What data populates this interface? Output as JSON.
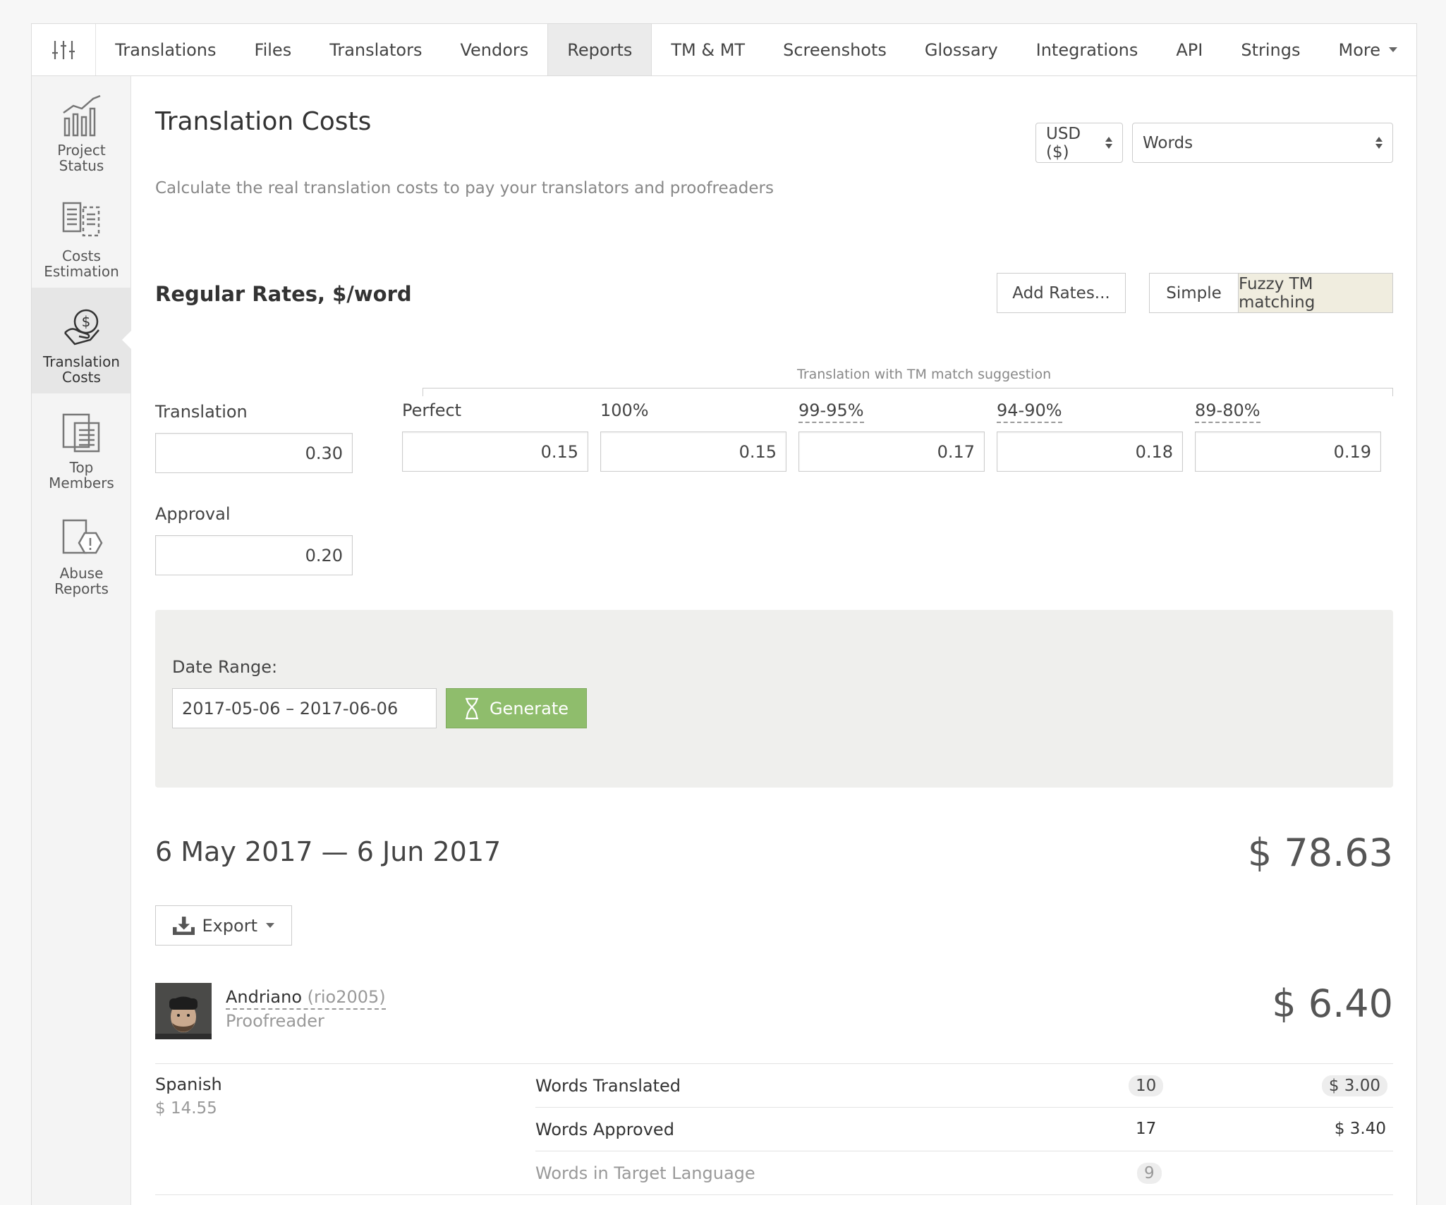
{
  "nav": {
    "tabs": [
      {
        "label": "Translations"
      },
      {
        "label": "Files"
      },
      {
        "label": "Translators"
      },
      {
        "label": "Vendors"
      },
      {
        "label": "Reports"
      },
      {
        "label": "TM & MT"
      },
      {
        "label": "Screenshots"
      },
      {
        "label": "Glossary"
      },
      {
        "label": "Integrations"
      },
      {
        "label": "API"
      },
      {
        "label": "Strings"
      },
      {
        "label": "More"
      }
    ],
    "active": "Reports"
  },
  "sidebar": {
    "items": [
      {
        "label": "Project\nStatus",
        "icon": "bar-chart-icon"
      },
      {
        "label": "Costs\nEstimation",
        "icon": "document-compare-icon"
      },
      {
        "label": "Translation\nCosts",
        "icon": "money-hand-icon"
      },
      {
        "label": "Top\nMembers",
        "icon": "document-list-icon"
      },
      {
        "label": "Abuse\nReports",
        "icon": "warning-document-icon"
      }
    ],
    "active": "Translation Costs"
  },
  "header": {
    "title": "Translation Costs",
    "subtitle": "Calculate the real translation costs to pay your translators and proofreaders",
    "currency": "USD ($)",
    "unit": "Words"
  },
  "rates": {
    "title": "Regular Rates, $/word",
    "add_rates_label": "Add Rates...",
    "mode_simple": "Simple",
    "mode_fuzzy": "Fuzzy TM matching",
    "tm_caption": "Translation with TM match suggestion",
    "translation_label": "Translation",
    "translation_value": "0.30",
    "approval_label": "Approval",
    "approval_value": "0.20",
    "tm": [
      {
        "label": "Perfect",
        "value": "0.15"
      },
      {
        "label": "100%",
        "value": "0.15"
      },
      {
        "label": "99-95%",
        "value": "0.17"
      },
      {
        "label": "94-90%",
        "value": "0.18"
      },
      {
        "label": "89-80%",
        "value": "0.19"
      }
    ]
  },
  "date_range": {
    "label": "Date Range:",
    "value": "2017-05-06 – 2017-06-06",
    "generate_label": "Generate"
  },
  "report": {
    "range_title": "6 May 2017 — 6 Jun 2017",
    "total": "$ 78.63",
    "export_label": "Export",
    "user": {
      "name": "Andriano",
      "handle": "(rio2005)",
      "role": "Proofreader",
      "total": "$ 6.40"
    },
    "language": "Spanish",
    "language_total": "$ 14.55",
    "rows": [
      {
        "label": "Words Translated",
        "count": "10",
        "amount": "$ 3.00"
      },
      {
        "label": "Words Approved",
        "count": "17",
        "amount": "$ 3.40"
      },
      {
        "label": "Words in Target Language",
        "count": "9",
        "amount": ""
      }
    ]
  }
}
